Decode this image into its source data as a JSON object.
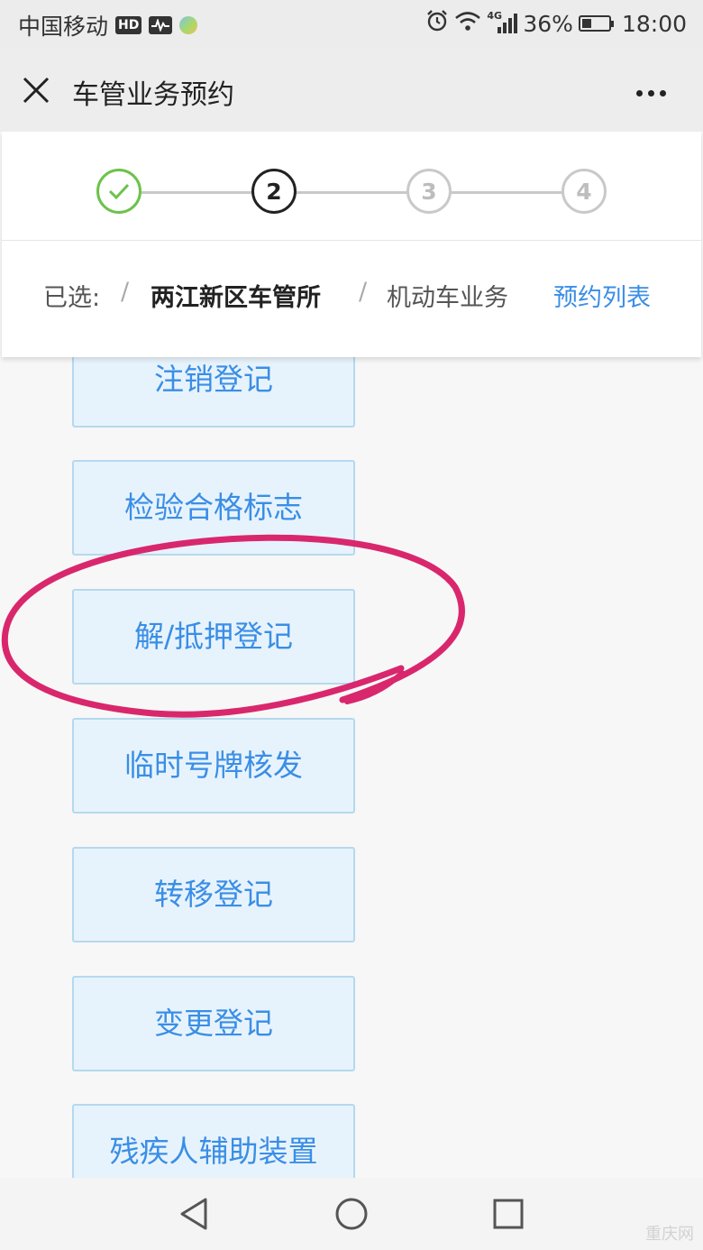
{
  "status_bar": {
    "carrier": "中国移动",
    "hd_badge": "HD",
    "network_type": "4G",
    "battery_percent": "36%",
    "battery_level": 0.36,
    "time": "18:00"
  },
  "title_bar": {
    "title": "车管业务预约"
  },
  "stepper": {
    "steps": [
      {
        "label": "1",
        "state": "done"
      },
      {
        "label": "2",
        "state": "active"
      },
      {
        "label": "3",
        "state": "pending"
      },
      {
        "label": "4",
        "state": "pending"
      }
    ]
  },
  "breadcrumb": {
    "label": "已选:",
    "separator": "/",
    "station": "两江新区车管所",
    "business_type": "机动车业务",
    "list_link": "预约列表"
  },
  "services": [
    "注销登记",
    "检验合格标志",
    "解/抵押登记",
    "临时号牌核发",
    "转移登记",
    "变更登记",
    "残疾人辅助装置"
  ],
  "watermark": "重庆网",
  "colors": {
    "accent": "#3a8ee6",
    "done": "#6cc24a",
    "annotation": "#d9276d",
    "button_bg": "#e7f3fc",
    "button_border": "#b5d9ee"
  }
}
